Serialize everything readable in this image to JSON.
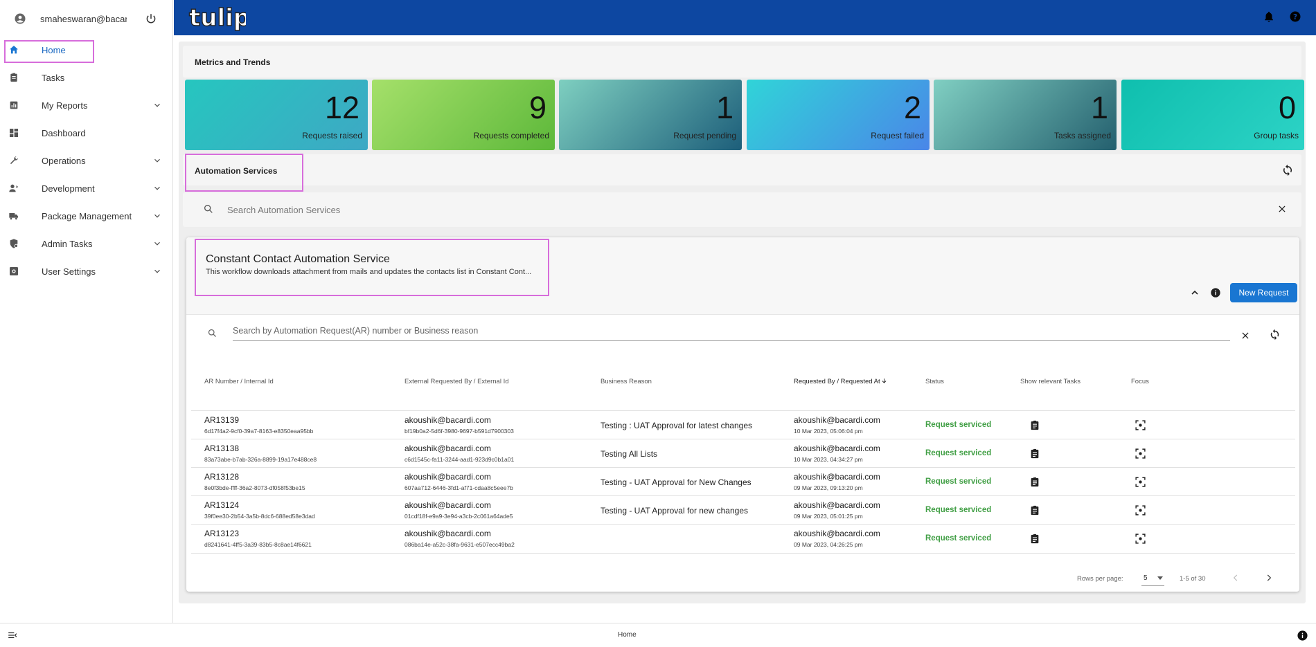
{
  "sidebar": {
    "user_email": "smaheswaran@bacar...",
    "items": [
      {
        "label": "Home",
        "active": true,
        "icon": "home-icon"
      },
      {
        "label": "Tasks",
        "icon": "clipboard-icon"
      },
      {
        "label": "My Reports",
        "icon": "report-icon",
        "expandable": true
      },
      {
        "label": "Dashboard",
        "icon": "dashboard-icon"
      },
      {
        "label": "Operations",
        "icon": "wrench-icon",
        "expandable": true
      },
      {
        "label": "Development",
        "icon": "developer-icon",
        "expandable": true
      },
      {
        "label": "Package Management",
        "icon": "truck-icon",
        "expandable": true
      },
      {
        "label": "Admin Tasks",
        "icon": "admin-shield-icon",
        "expandable": true
      },
      {
        "label": "User Settings",
        "icon": "settings-box-icon",
        "expandable": true
      }
    ]
  },
  "header": {
    "logo_text": "tulip",
    "accent": "#0d47a1"
  },
  "metrics": {
    "title": "Metrics and Trends",
    "cards": [
      {
        "value": "12",
        "label": "Requests raised"
      },
      {
        "value": "9",
        "label": "Requests completed"
      },
      {
        "value": "1",
        "label": "Request pending"
      },
      {
        "value": "2",
        "label": "Request failed"
      },
      {
        "value": "1",
        "label": "Tasks assigned"
      },
      {
        "value": "0",
        "label": "Group tasks"
      }
    ]
  },
  "automation": {
    "title": "Automation Services",
    "search_placeholder": "Search Automation Services"
  },
  "service": {
    "title": "Constant Contact Automation Service",
    "description": "This workflow downloads attachment from mails and updates the contacts list in Constant Cont...",
    "new_request_label": "New Request",
    "ar_search_placeholder": "Search by Automation Request(AR) number or Business reason",
    "columns": [
      "AR Number / Internal Id",
      "External Requested By / External Id",
      "Business Reason",
      "Requested By / Requested At",
      "Status",
      "Show relevant Tasks",
      "Focus"
    ],
    "rows": [
      {
        "ar": "AR13139",
        "internal_id": "6d17f4a2-9cf0-39a7-8163-e8350eaa95bb",
        "ext_by": "akoushik@bacardi.com",
        "ext_id": "bf19b0a2-5d6f-3980-9697-b591d7900303",
        "reason": "Testing : UAT Approval for latest changes",
        "req_by": "akoushik@bacardi.com",
        "req_at": "10 Mar 2023, 05:06:04 pm",
        "status": "Request serviced"
      },
      {
        "ar": "AR13138",
        "internal_id": "83a73abe-b7ab-326a-8899-19a17e488ce8",
        "ext_by": "akoushik@bacardi.com",
        "ext_id": "c6d1545c-fa11-3244-aad1-923d9c0b1a01",
        "reason": "Testing All Lists",
        "req_by": "akoushik@bacardi.com",
        "req_at": "10 Mar 2023, 04:34:27 pm",
        "status": "Request serviced"
      },
      {
        "ar": "AR13128",
        "internal_id": "8e0f3bde-ffff-36a2-8073-df058f53be15",
        "ext_by": "akoushik@bacardi.com",
        "ext_id": "607aa712-6446-3fd1-af71-cdaa8c5eee7b",
        "reason": "Testing - UAT Approval for New Changes",
        "req_by": "akoushik@bacardi.com",
        "req_at": "09 Mar 2023, 09:13:20 pm",
        "status": "Request serviced"
      },
      {
        "ar": "AR13124",
        "internal_id": "39f0ee30-2b54-3a5b-8dc6-688ed58e3dad",
        "ext_by": "akoushik@bacardi.com",
        "ext_id": "01cdf18f-e9a9-3e94-a3cb-2c061a64ade5",
        "reason": "Testing - UAT Approval for new changes",
        "req_by": "akoushik@bacardi.com",
        "req_at": "09 Mar 2023, 05:01:25 pm",
        "status": "Request serviced"
      },
      {
        "ar": "AR13123",
        "internal_id": "d8241641-4ff5-3a39-83b5-8c8ae14f6621",
        "ext_by": "akoushik@bacardi.com",
        "ext_id": "086ba14e-a52c-38fa-9631-e507ecc49ba2",
        "reason": "",
        "req_by": "akoushik@bacardi.com",
        "req_at": "09 Mar 2023, 04:26:25 pm",
        "status": "Request serviced"
      }
    ],
    "pagination": {
      "rows_per_page_label": "Rows per page:",
      "rows_per_page": "5",
      "range": "1-5 of 30"
    }
  },
  "footer": {
    "label": "Home"
  }
}
